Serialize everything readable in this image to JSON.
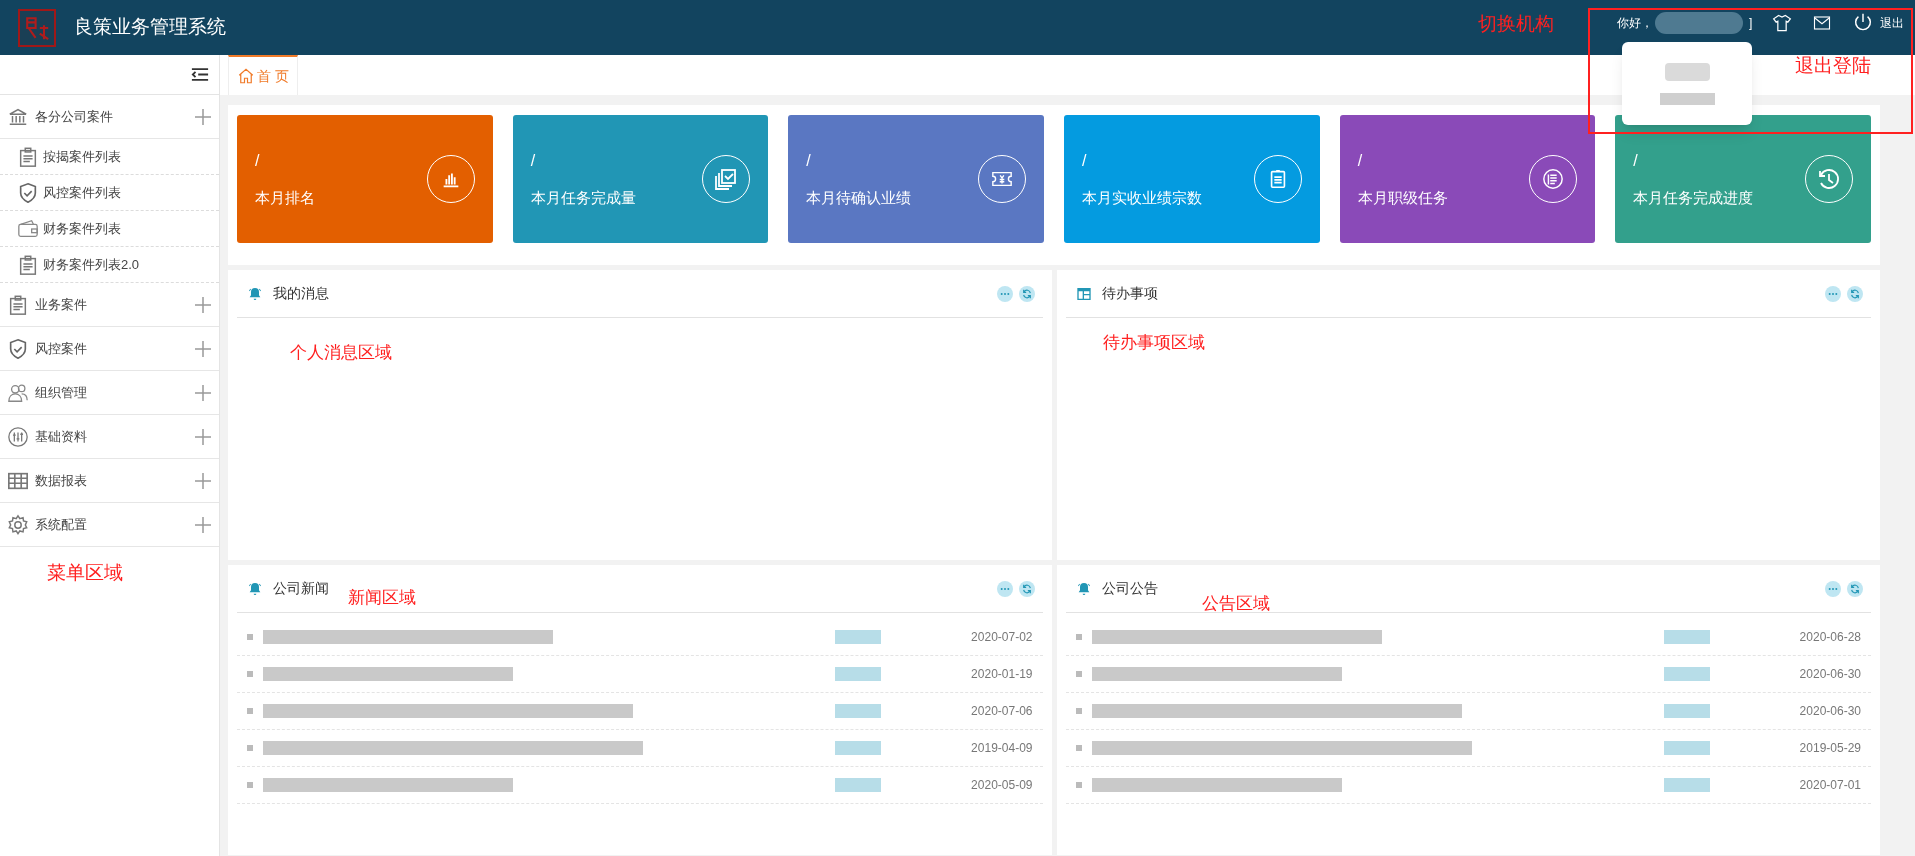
{
  "header": {
    "title": "良策业务管理系统",
    "greeting": "你好，",
    "bracket": "]",
    "logout": "退出",
    "annotation": "切换机构",
    "logout_annotation": "退出登陆"
  },
  "sidebar": {
    "annotation": "菜单区域",
    "items": [
      {
        "label": "各分公司案件",
        "children": [
          {
            "label": "按揭案件列表"
          },
          {
            "label": "风控案件列表"
          },
          {
            "label": "财务案件列表"
          },
          {
            "label": "财务案件列表2.0"
          }
        ]
      },
      {
        "label": "业务案件"
      },
      {
        "label": "风控案件"
      },
      {
        "label": "组织管理"
      },
      {
        "label": "基础资料"
      },
      {
        "label": "数据报表"
      },
      {
        "label": "系统配置"
      }
    ]
  },
  "tabs": [
    {
      "label": "首 页",
      "selected": true
    }
  ],
  "cards": [
    {
      "value": "/",
      "label": "本月排名",
      "color": "#e35f00"
    },
    {
      "value": "/",
      "label": "本月任务完成量",
      "color": "#2196b5"
    },
    {
      "value": "/",
      "label": "本月待确认业绩",
      "color": "#5a77c2"
    },
    {
      "value": "/",
      "label": "本月实收业绩宗数",
      "color": "#049be0"
    },
    {
      "value": "/",
      "label": "本月职级任务",
      "color": "#8a4ab8"
    },
    {
      "value": "/",
      "label": "本月任务完成进度",
      "color": "#33a08c"
    }
  ],
  "panels": [
    {
      "title": "我的消息",
      "annotation": "个人消息区域"
    },
    {
      "title": "待办事项",
      "annotation": "待办事项区域"
    },
    {
      "title": "公司新闻",
      "annotation": "新闻区域",
      "rows": [
        {
          "date": "2020-07-02"
        },
        {
          "date": "2020-01-19"
        },
        {
          "date": "2020-07-06"
        },
        {
          "date": "2019-04-09"
        },
        {
          "date": "2020-05-09"
        }
      ]
    },
    {
      "title": "公司公告",
      "annotation": "公告区域",
      "rows": [
        {
          "date": "2020-06-28"
        },
        {
          "date": "2020-06-30"
        },
        {
          "date": "2020-06-30"
        },
        {
          "date": "2019-05-29"
        },
        {
          "date": "2020-07-01"
        }
      ]
    }
  ]
}
